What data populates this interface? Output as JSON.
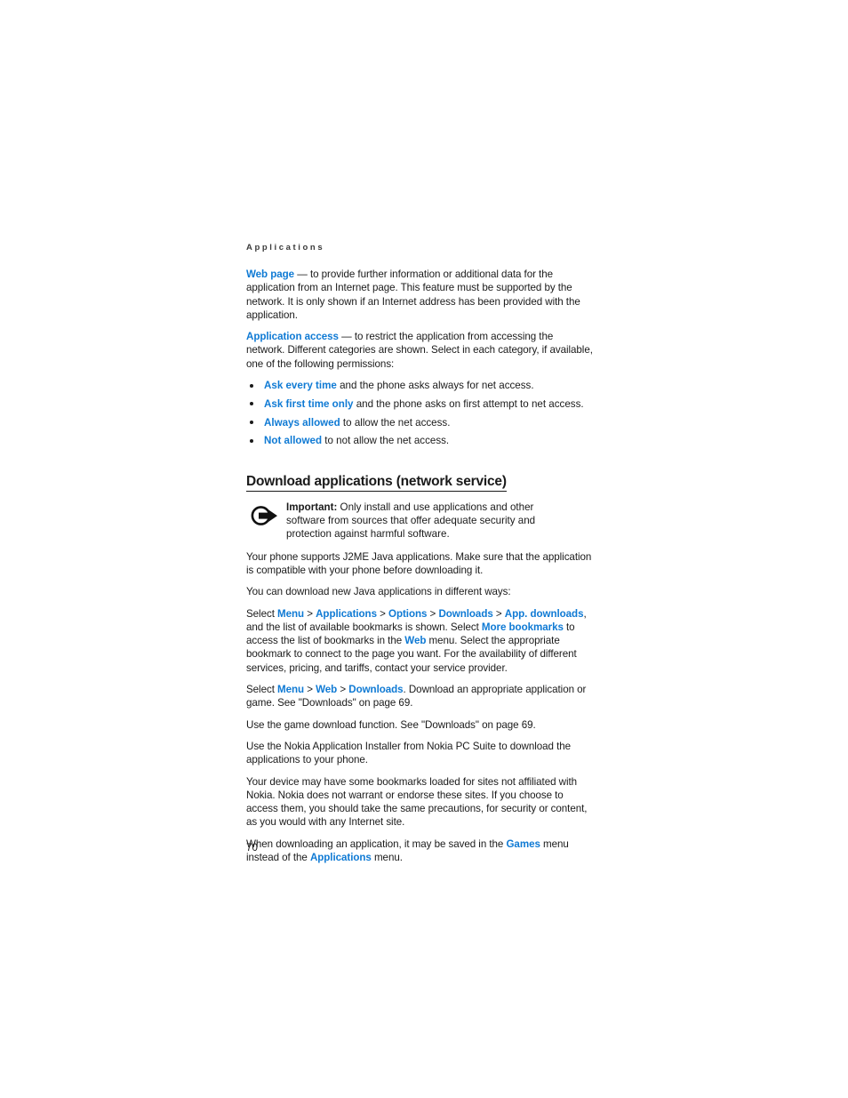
{
  "document": {
    "running_header": "Applications",
    "page_number": "70",
    "link_color": "#0f7ad4",
    "text_color": "#1a1a1a"
  },
  "intro": {
    "web_page": {
      "term": "Web page",
      "dash": " — ",
      "text": "to provide further information or additional data for the application from an Internet page. This feature must be supported by the network. It is only shown if an Internet address has been provided with the application."
    },
    "application_access": {
      "term": "Application access",
      "dash": " — ",
      "text": "to restrict the application from accessing the network. Different categories are shown. Select in each category, if available, one of the following permissions:"
    }
  },
  "permissions": [
    {
      "term": "Ask every time",
      "text": " and the phone asks always for net access."
    },
    {
      "term": "Ask first time only",
      "text": " and the phone asks on first attempt to net access."
    },
    {
      "term": "Always allowed",
      "text": " to allow the net access."
    },
    {
      "term": "Not allowed",
      "text": " to not allow the net access."
    }
  ],
  "section": {
    "heading": "Download applications (network service)",
    "note": {
      "icon": "important-arrow-icon",
      "label": "Important:",
      "text": " Only install and use applications and other software from sources that offer adequate security and protection against harmful software."
    },
    "paragraphs": {
      "p1": "Your phone supports J2ME Java applications. Make sure that the application is compatible with your phone before downloading it.",
      "p2": "You can download new Java applications in different ways:",
      "p3_prefix": "Select ",
      "p3_path": [
        "Menu",
        "Applications",
        "Options",
        "Downloads",
        "App. downloads"
      ],
      "p3_mid": ", and the list of available bookmarks is shown. Select ",
      "p3_link2": "More bookmarks",
      "p3_mid2": " to access the list of bookmarks in the ",
      "p3_link3": "Web",
      "p3_suffix": " menu. Select the appropriate bookmark to connect to the page you want. For the availability of different services, pricing, and tariffs, contact your service provider.",
      "p4_prefix": "Select ",
      "p4_path": [
        "Menu",
        "Web",
        "Downloads"
      ],
      "p4_suffix": ". Download an appropriate application or game. See \"Downloads\" on page 69.",
      "p5": "Use the game download function. See \"Downloads\" on page 69.",
      "p6": "Use the Nokia Application Installer from Nokia PC Suite to download the applications to your phone.",
      "p7": "Your device may have some bookmarks loaded for sites not affiliated with Nokia. Nokia does not warrant or endorse these sites. If you choose to access them, you should take the same precautions, for security or content, as you would with any Internet site.",
      "p8_prefix": "When downloading an application, it may be saved in the ",
      "p8_link1": "Games",
      "p8_mid": " menu instead of the ",
      "p8_link2": "Applications",
      "p8_suffix": " menu."
    }
  },
  "separators": {
    "gt": " > "
  }
}
